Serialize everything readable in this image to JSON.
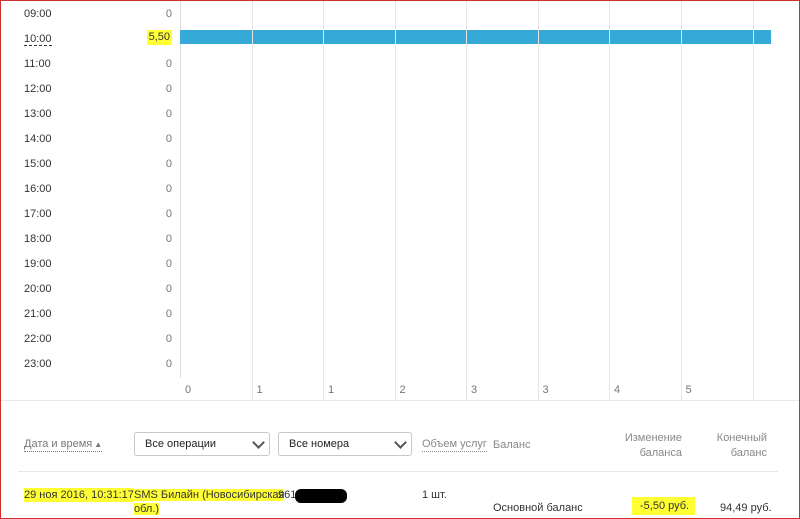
{
  "chart": {
    "hours": [
      {
        "label": "09:00",
        "value": "0"
      },
      {
        "label": "10:00",
        "value": "5,50"
      },
      {
        "label": "11:00",
        "value": "0"
      },
      {
        "label": "12:00",
        "value": "0"
      },
      {
        "label": "13:00",
        "value": "0"
      },
      {
        "label": "14:00",
        "value": "0"
      },
      {
        "label": "15:00",
        "value": "0"
      },
      {
        "label": "16:00",
        "value": "0"
      },
      {
        "label": "17:00",
        "value": "0"
      },
      {
        "label": "18:00",
        "value": "0"
      },
      {
        "label": "19:00",
        "value": "0"
      },
      {
        "label": "20:00",
        "value": "0"
      },
      {
        "label": "21:00",
        "value": "0"
      },
      {
        "label": "22:00",
        "value": "0"
      },
      {
        "label": "23:00",
        "value": "0"
      }
    ],
    "x_ticks": [
      "0",
      "1",
      "1",
      "2",
      "3",
      "3",
      "4",
      "5"
    ],
    "bar_color": "#35a9d8",
    "highlight_color": "#ffff33"
  },
  "chart_data": {
    "type": "bar",
    "orientation": "horizontal",
    "categories": [
      "09:00",
      "10:00",
      "11:00",
      "12:00",
      "13:00",
      "14:00",
      "15:00",
      "16:00",
      "17:00",
      "18:00",
      "19:00",
      "20:00",
      "21:00",
      "22:00",
      "23:00"
    ],
    "values": [
      0,
      5.5,
      0,
      0,
      0,
      0,
      0,
      0,
      0,
      0,
      0,
      0,
      0,
      0,
      0
    ],
    "xlim": [
      0,
      5.5
    ],
    "grid": true
  },
  "filters": {
    "sort_label": "Дата и время",
    "operations_select": "Все операции",
    "numbers_select": "Все номера",
    "volume_label": "Объем услуг",
    "balance_label": "Баланс",
    "change_label_1": "Изменение",
    "change_label_2": "баланса",
    "final_label_1": "Конечный",
    "final_label_2": "баланс"
  },
  "row": {
    "datetime": "29 ноя 2016, 10:31:17",
    "service_1": "SMS Билайн (Новосибирская",
    "service_2": "обл.)",
    "number": "961-",
    "volume": "1 шт.",
    "balance_type": "Основной баланс",
    "change": "-5,50 руб.",
    "final": "94,49 руб."
  }
}
